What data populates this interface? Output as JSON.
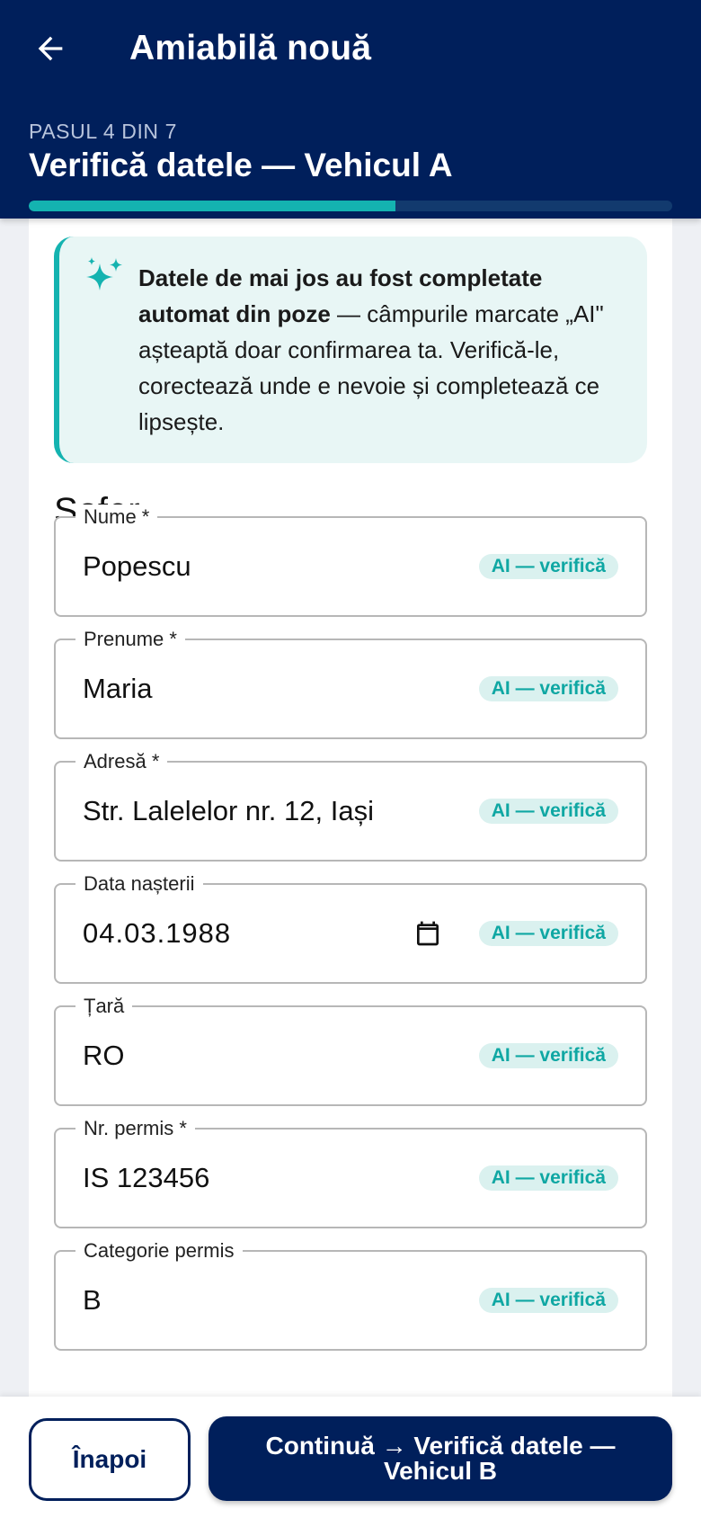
{
  "header": {
    "title": "Amiabilă nouă",
    "step_label": "PASUL 4 DIN 7",
    "step_title": "Verifică datele — Vehicul A",
    "progress": 0.57
  },
  "ai_info": {
    "bold": "Datele de mai jos au fost completate automat din poze",
    "text": " — câmpurile marcate „AI\" așteaptă doar confirmarea ta. Verifică-le, corectează unde e nevoie și completează ce lipsește."
  },
  "section": {
    "title": "Șofer"
  },
  "fields": [
    {
      "label": "Nume *",
      "value": "Popescu",
      "badge": "AI — verifică"
    },
    {
      "label": "Prenume *",
      "value": "Maria",
      "badge": "AI — verifică"
    },
    {
      "label": "Adresă *",
      "value": "Str. Lalelelor nr. 12, Iași",
      "badge": "AI — verifică"
    },
    {
      "label": "Data nașterii",
      "value": "04.03.1988",
      "badge": "AI — verifică"
    },
    {
      "label": "Țară",
      "value": "RO",
      "badge": "AI — verifică"
    },
    {
      "label": "Nr. permis *",
      "value": "IS 123456",
      "badge": "AI — verifică"
    },
    {
      "label": "Categorie permis",
      "value": "B",
      "badge": "AI — verifică"
    }
  ],
  "footer": {
    "back_label": "Înapoi",
    "next_label": "Continuă → Verifică datele — Vehicul B"
  },
  "colors": {
    "primary": "#001f5b",
    "accent": "#14b3b0"
  },
  "icons": {
    "back": "arrow-left-icon",
    "ai": "sparkle-icon",
    "date": "calendar-icon"
  }
}
